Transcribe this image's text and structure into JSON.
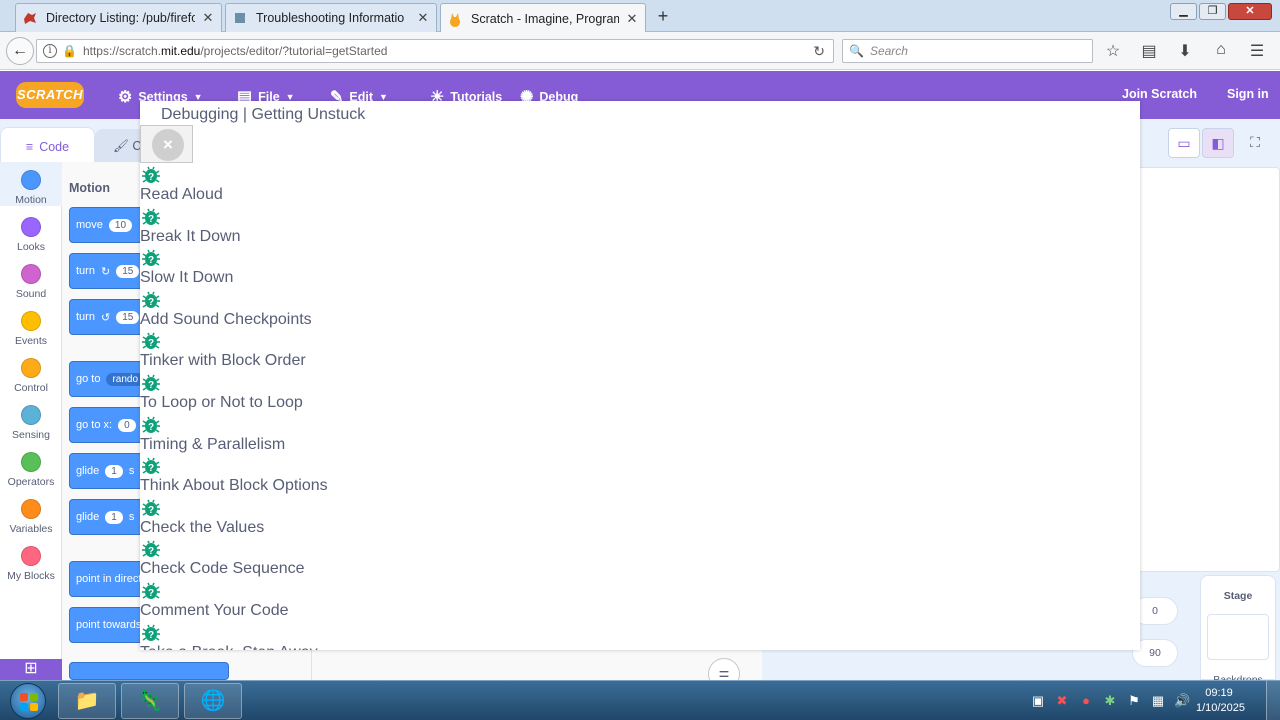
{
  "browser": {
    "tabs": [
      {
        "title": "Directory Listing: /pub/firefo",
        "favicon": "red-dino-icon"
      },
      {
        "title": "Troubleshooting Informatio",
        "favicon": "puzzle-icon"
      },
      {
        "title": "Scratch - Imagine, Program",
        "favicon": "scratch-cat-icon"
      }
    ],
    "url_prefix": "https://scratch.",
    "url_domain": "mit.edu",
    "url_path": "/projects/editor/?tutorial=getStarted",
    "search_placeholder": "Search"
  },
  "scratch": {
    "logo": "SCRATCH",
    "menu": {
      "settings": "Settings",
      "file": "File",
      "edit": "Edit",
      "tutorials": "Tutorials",
      "debug": "Debug",
      "join": "Join Scratch",
      "signin": "Sign in"
    },
    "tabs": {
      "code": "Code",
      "costumes": "C"
    },
    "categories": [
      {
        "label": "Motion",
        "color": "#4c97ff"
      },
      {
        "label": "Looks",
        "color": "#9966ff"
      },
      {
        "label": "Sound",
        "color": "#cf63cf"
      },
      {
        "label": "Events",
        "color": "#ffbf00"
      },
      {
        "label": "Control",
        "color": "#ffab19"
      },
      {
        "label": "Sensing",
        "color": "#5cb1d6"
      },
      {
        "label": "Operators",
        "color": "#59c059"
      },
      {
        "label": "Variables",
        "color": "#ff8c1a"
      },
      {
        "label": "My Blocks",
        "color": "#ff6680"
      }
    ],
    "palette_title": "Motion",
    "blocks": [
      {
        "label": "move",
        "value": "10"
      },
      {
        "label": "turn",
        "value": "15"
      },
      {
        "label": "turn",
        "value": "15"
      },
      {
        "label": "go to",
        "value": "rando"
      },
      {
        "label": "go to x:",
        "value": "0"
      },
      {
        "label": "glide",
        "value": "1",
        "tail": "s"
      },
      {
        "label": "glide",
        "value": "1",
        "tail": "s"
      },
      {
        "label": "point in directi"
      },
      {
        "label": "point towards"
      }
    ],
    "sprite_fields": {
      "x": "0",
      "direction": "90"
    },
    "stage_label": "Stage",
    "backdrops_label": "Backdrops",
    "zoom_reset": "="
  },
  "tutorial": {
    "title": "Debugging | Getting Unstuck",
    "close": "×",
    "tips": [
      "Read Aloud",
      "Break It Down",
      "Slow It Down",
      "Add Sound Checkpoints",
      "Tinker with Block Order",
      "To Loop or Not to Loop",
      "Timing & Parallelism",
      "Think About Block Options",
      "Check the Values",
      "Check Code Sequence",
      "Comment Your Code",
      "Take a Break, Step Away"
    ]
  },
  "taskbar": {
    "time": "09:19",
    "date": "1/10/2025"
  }
}
